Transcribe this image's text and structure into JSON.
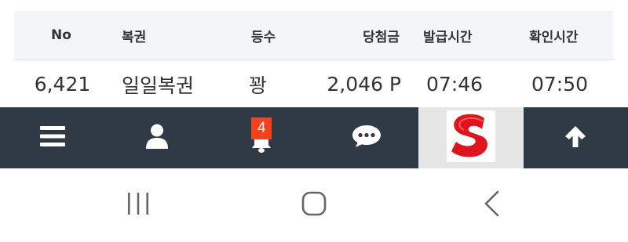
{
  "table": {
    "headers": [
      "No",
      "복권",
      "등수",
      "당첨금",
      "발급시간",
      "확인시간"
    ],
    "rows": [
      {
        "no": "6,421",
        "lottery": "일일복권",
        "rank": "꽝",
        "prize": "2,046 P",
        "issued": "07:46",
        "checked": "07:50"
      }
    ]
  },
  "nav": {
    "badge_count": "4",
    "items": [
      "menu-icon",
      "user-icon",
      "bell-icon",
      "chat-icon",
      "logo",
      "arrow-up-icon"
    ]
  },
  "colors": {
    "nav_bg": "#2f3a44",
    "badge": "#f2421c",
    "logo_red": "#e0141c",
    "header_bg": "#f4f5f7"
  }
}
